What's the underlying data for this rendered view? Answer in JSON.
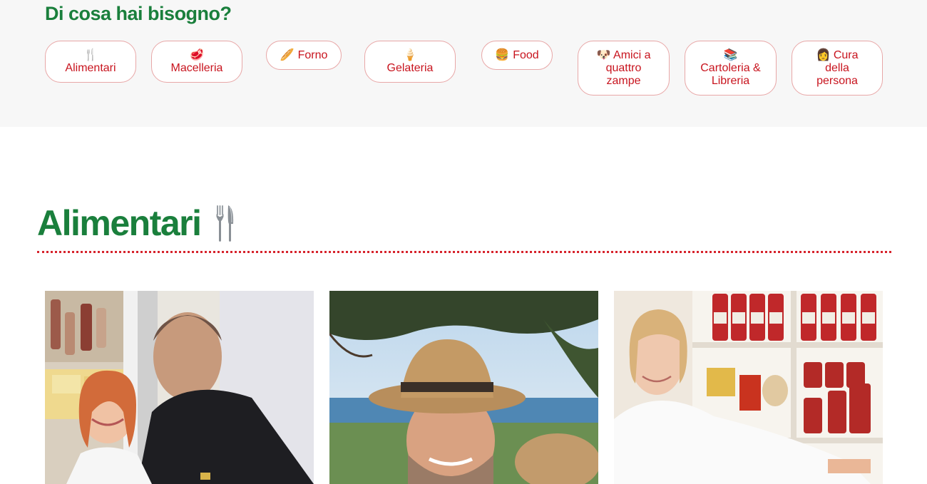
{
  "needs": {
    "title": "Di cosa hai bisogno?",
    "categories": [
      {
        "icon": "fork-knife-icon",
        "label": "Alimentari"
      },
      {
        "icon": "meat-icon",
        "label": "Macelleria"
      },
      {
        "icon": "baguette-icon",
        "label": "Forno"
      },
      {
        "icon": "ice-cream-icon",
        "label": "Gelateria"
      },
      {
        "icon": "burger-icon",
        "label": "Food"
      },
      {
        "icon": "dog-icon",
        "label_lines": [
          "Amici a",
          "quattro",
          "zampe"
        ]
      },
      {
        "icon": "books-icon",
        "label_lines": [
          "Cartoleria &",
          "Libreria"
        ]
      },
      {
        "icon": "woman-icon",
        "label_lines": [
          "Cura",
          "della",
          "persona"
        ]
      }
    ]
  },
  "section": {
    "title": "Alimentari",
    "icon": "fork-knife-icon"
  },
  "colors": {
    "green": "#1a7f3c",
    "red": "#c8141e",
    "pill_border": "#e8a7a7",
    "band": "#f7f7f7"
  },
  "cards": [
    {
      "photo": "two-shopkeepers-at-deli-counter"
    },
    {
      "photo": "man-in-straw-hat-by-the-sea"
    },
    {
      "photo": "woman-chef-in-pantry-shop"
    }
  ]
}
